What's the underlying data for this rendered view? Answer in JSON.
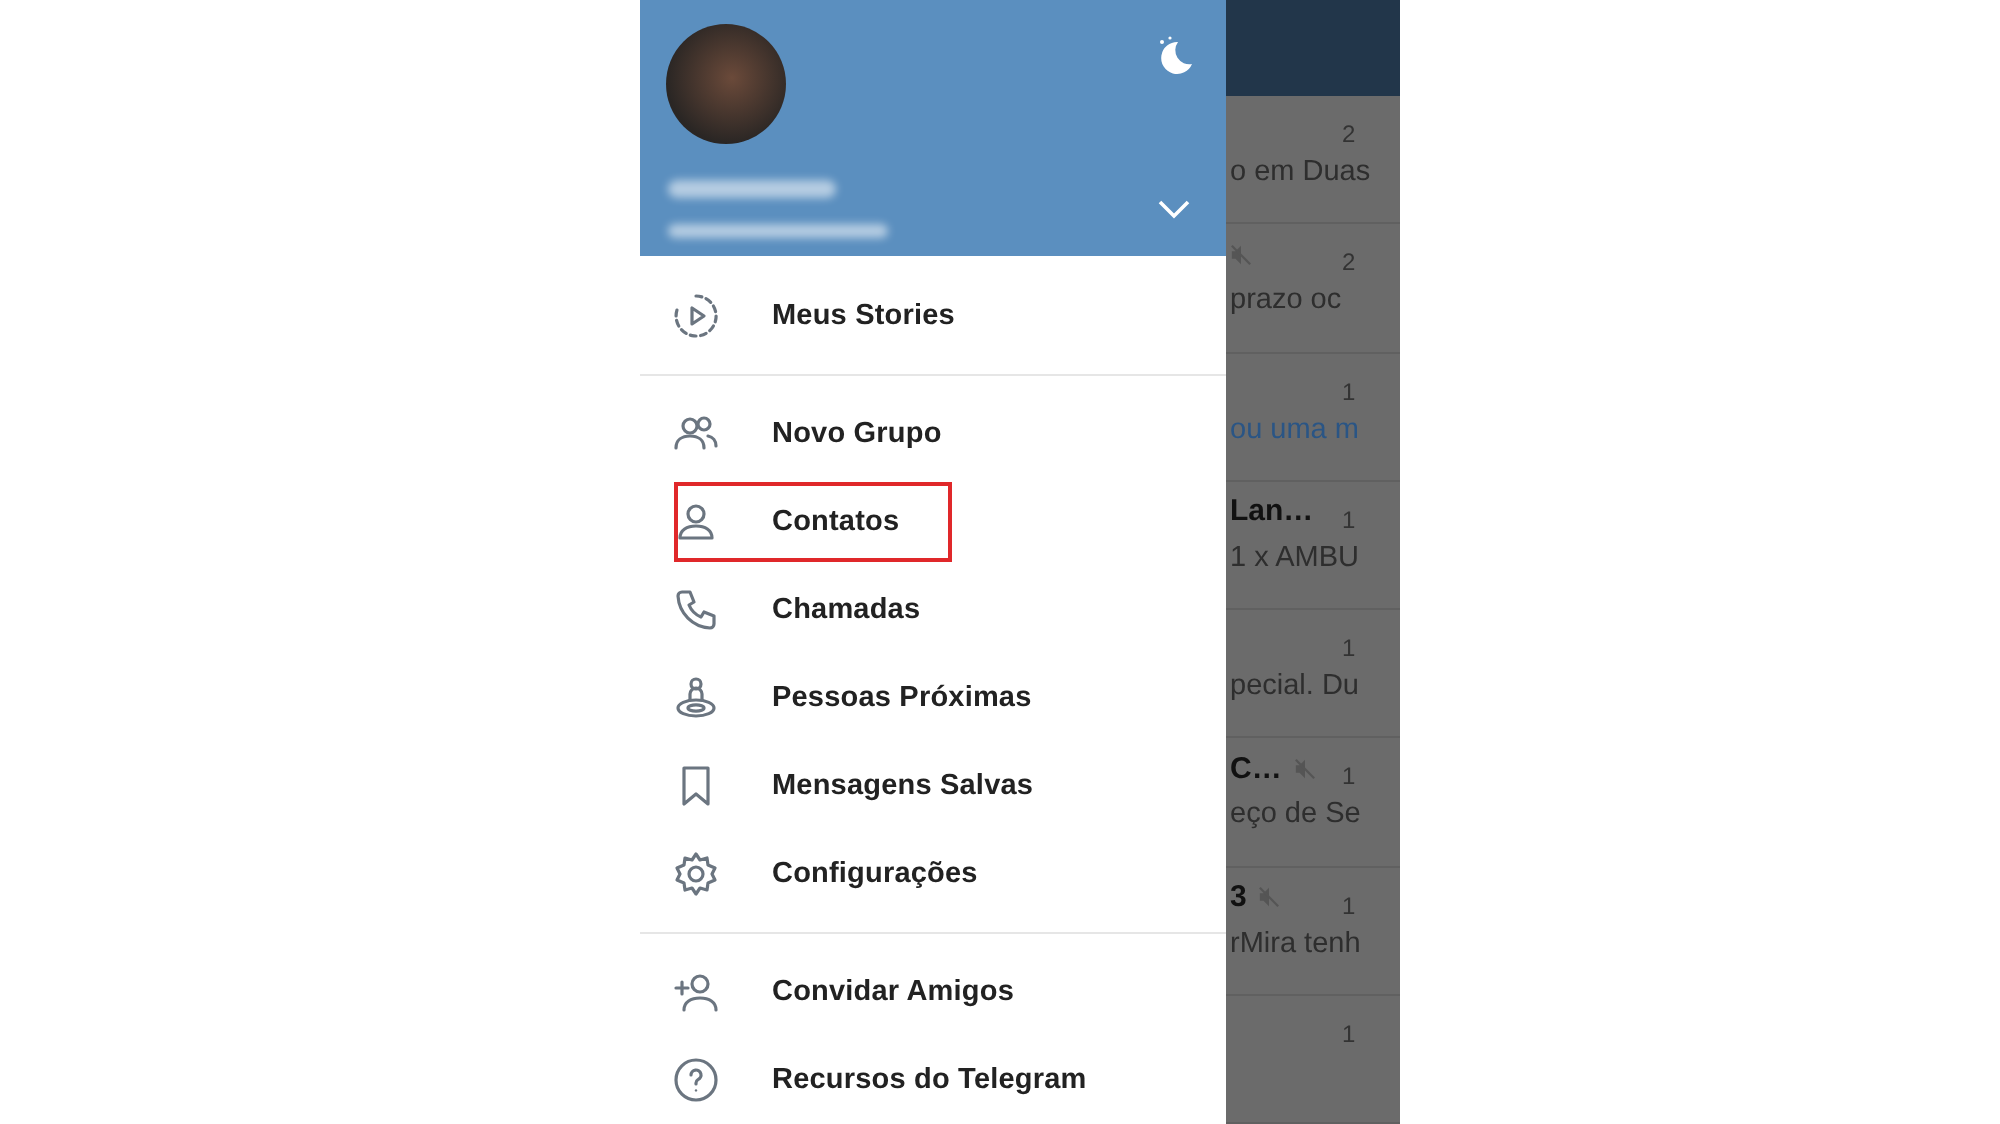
{
  "drawer": {
    "menu_sections": [
      [
        {
          "kind": "stories",
          "label": "Meus Stories",
          "highlighted": false
        }
      ],
      [
        {
          "kind": "group",
          "label": "Novo Grupo",
          "highlighted": false
        },
        {
          "kind": "contact",
          "label": "Contatos",
          "highlighted": true
        },
        {
          "kind": "call",
          "label": "Chamadas",
          "highlighted": false
        },
        {
          "kind": "nearby",
          "label": "Pessoas Próximas",
          "highlighted": false
        },
        {
          "kind": "saved",
          "label": "Mensagens Salvas",
          "highlighted": false
        },
        {
          "kind": "settings",
          "label": "Configurações",
          "highlighted": false
        }
      ],
      [
        {
          "kind": "invite",
          "label": "Convidar Amigos",
          "highlighted": false
        },
        {
          "kind": "help",
          "label": "Recursos do Telegram",
          "highlighted": false
        }
      ]
    ]
  },
  "chat_list": [
    {
      "time": "2",
      "preview": "o em Duas",
      "muted": false,
      "preview_link": false
    },
    {
      "time": "2",
      "preview": "prazo   oc",
      "muted": true,
      "preview_link": false
    },
    {
      "time": "1",
      "preview": "ou uma m",
      "muted": false,
      "preview_link": true
    },
    {
      "title": "Lan…",
      "time": "1",
      "preview": "1 x AMBU",
      "muted": false,
      "preview_link": false
    },
    {
      "time": "1",
      "preview": "pecial.  Du",
      "muted": false,
      "preview_link": false
    },
    {
      "title": "C…",
      "time": "1",
      "preview": "eço de Se",
      "muted": true,
      "preview_link": false
    },
    {
      "title": "3",
      "time": "1",
      "preview": "rMira tenh",
      "muted": true,
      "preview_link": false
    },
    {
      "time": "1",
      "muted": false
    }
  ]
}
